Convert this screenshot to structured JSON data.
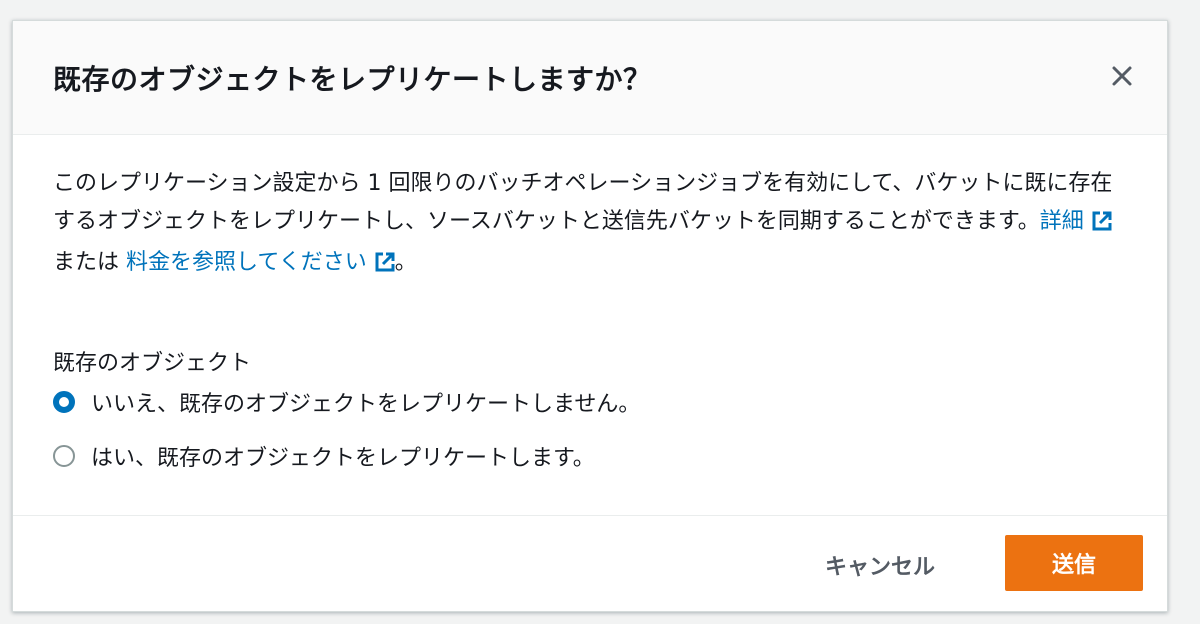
{
  "dialog": {
    "title": "既存のオブジェクトをレプリケートしますか？",
    "close_icon": "close-icon",
    "description": {
      "text_before": "このレプリケーション設定から 1 回限りのバッチオペレーションジョブを有効にして、バケットに既に存在するオブジェクトをレプリケートし、ソースバケットと送信先バケットを同期することができます。",
      "learn_more_link": "詳細",
      "text_middle": "または",
      "pricing_link": "料金を参照してください",
      "text_after": "。",
      "external_icon": "external-link-icon"
    },
    "field": {
      "label": "既存のオブジェクト",
      "options": [
        {
          "label": "いいえ、既存のオブジェクトをレプリケートしません。",
          "selected": true
        },
        {
          "label": "はい、既存のオブジェクトをレプリケートします。",
          "selected": false
        }
      ]
    },
    "footer": {
      "cancel_label": "キャンセル",
      "submit_label": "送信"
    }
  },
  "colors": {
    "link": "#0073bb",
    "primary_button": "#ec7211",
    "radio_selected": "#0073bb",
    "text": "#16191f",
    "secondary_text": "#545b64"
  }
}
